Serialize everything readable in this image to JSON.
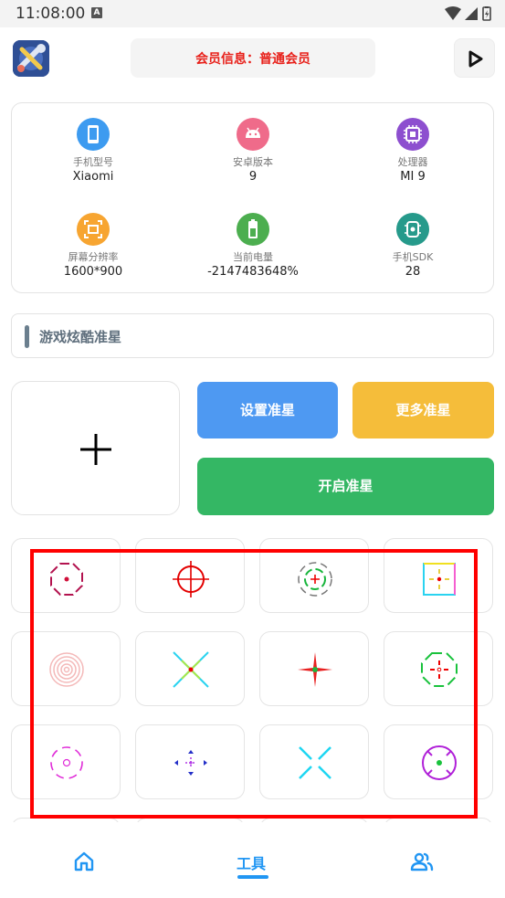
{
  "status_bar": {
    "time": "11:08:00",
    "notification_glyph": "A"
  },
  "header": {
    "member_info": "会员信息：普通会员"
  },
  "device_info": [
    {
      "label": "手机型号",
      "value": "Xiaomi",
      "icon": "phone-icon",
      "color": "#3d9bf0"
    },
    {
      "label": "安卓版本",
      "value": "9",
      "icon": "android-icon",
      "color": "#ef6b8a"
    },
    {
      "label": "处理器",
      "value": "MI 9",
      "icon": "cpu-icon",
      "color": "#8d4fcf"
    },
    {
      "label": "屏幕分辨率",
      "value": "1600*900",
      "icon": "screen-icon",
      "color": "#f7a531"
    },
    {
      "label": "当前电量",
      "value": "-2147483648%",
      "icon": "battery-icon",
      "color": "#4cae4f"
    },
    {
      "label": "手机SDK",
      "value": "28",
      "icon": "sdk-icon",
      "color": "#269a8b"
    }
  ],
  "section": {
    "title": "游戏炫酷准星"
  },
  "preview": {
    "placeholder_icon": "plus-icon"
  },
  "buttons": {
    "set": "设置准星",
    "more": "更多准星",
    "open": "开启准星"
  },
  "colors": {
    "blue": "#4e99f2",
    "yellow": "#f5bd3a",
    "green": "#34b764",
    "highlight": "#ff0000",
    "accent": "#2196f3"
  },
  "nav": {
    "home_icon": "home-icon",
    "tools": "工具",
    "users_icon": "users-icon"
  }
}
